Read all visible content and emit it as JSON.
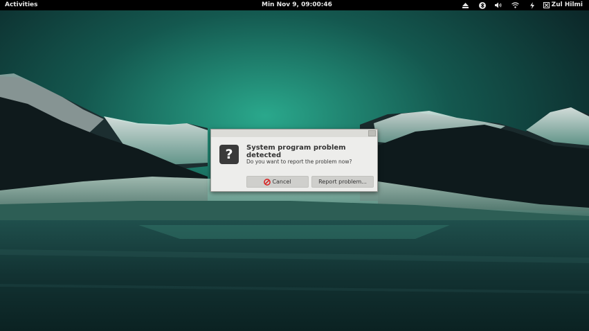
{
  "top_bar": {
    "activities_label": "Activities",
    "clock": "Min Nov  9, 09:00:46",
    "tray_icons": [
      "eject-icon",
      "bluetooth-icon",
      "volume-icon",
      "wifi-icon",
      "power-icon"
    ],
    "user_name": "Zul Hilmi"
  },
  "dialog": {
    "icon": "question-icon",
    "icon_glyph": "?",
    "title": "System program problem detected",
    "message": "Do you want to report the problem now?",
    "cancel_label": "Cancel",
    "report_label": "Report problem..."
  },
  "colors": {
    "panel_bg": "#000000",
    "dialog_bg": "#ededeb",
    "wallpaper_teal": "#1f8a74"
  }
}
